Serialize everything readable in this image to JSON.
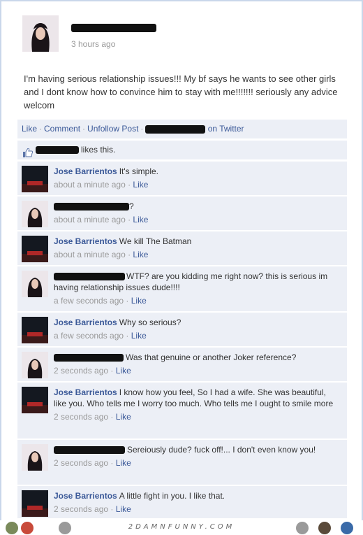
{
  "post": {
    "time": "3 hours ago",
    "text": "I'm having serious relationship issues!!! My bf says he wants to see other girls and I dont know how to convince him to stay with me!!!!!!! seriously any advice welcom",
    "actions": {
      "like": "Like",
      "comment": "Comment",
      "unfollow": "Unfollow Post",
      "on_twitter": "on Twitter"
    },
    "likes_text": "likes this."
  },
  "comments": [
    {
      "author": "Jose Barrientos",
      "text": "It's simple.",
      "time": "about a minute ago",
      "like": "Like"
    },
    {
      "author": "",
      "text": "?",
      "time": "about a minute ago",
      "like": "Like"
    },
    {
      "author": "Jose Barrientos",
      "text": "We kill The Batman",
      "time": "about a minute ago",
      "like": "Like"
    },
    {
      "author": "",
      "text": "WTF? are you kidding me right now? this is serious im having relationship issues dude!!!!",
      "time": "a few seconds ago",
      "like": "Like"
    },
    {
      "author": "Jose Barrientos",
      "text": "Why so serious?",
      "time": "a few seconds ago",
      "like": "Like"
    },
    {
      "author": "",
      "text": "Was that genuine or another Joker reference?",
      "time": "2 seconds ago",
      "like": "Like"
    },
    {
      "author": "Jose Barrientos",
      "text": "I know how you feel, So I had a wife. She was beautiful, like you. Who tells me I worry too much. Who tells me I ought to smile more",
      "time": "2 seconds ago",
      "like": "Like"
    },
    {
      "author": "",
      "text": "Sereiously dude? fuck off!... I don't even know you!",
      "time": "2 seconds ago",
      "like": "Like"
    },
    {
      "author": "Jose Barrientos",
      "text": "A little fight in you. I like that.",
      "time": "2 seconds ago",
      "like": "Like"
    }
  ],
  "footer": {
    "watermark": "2DAMNFUNNY.COM"
  },
  "colors": {
    "link": "#3b5998",
    "panel": "#eceff6",
    "muted": "#999999",
    "border": "#c9d7ea"
  }
}
